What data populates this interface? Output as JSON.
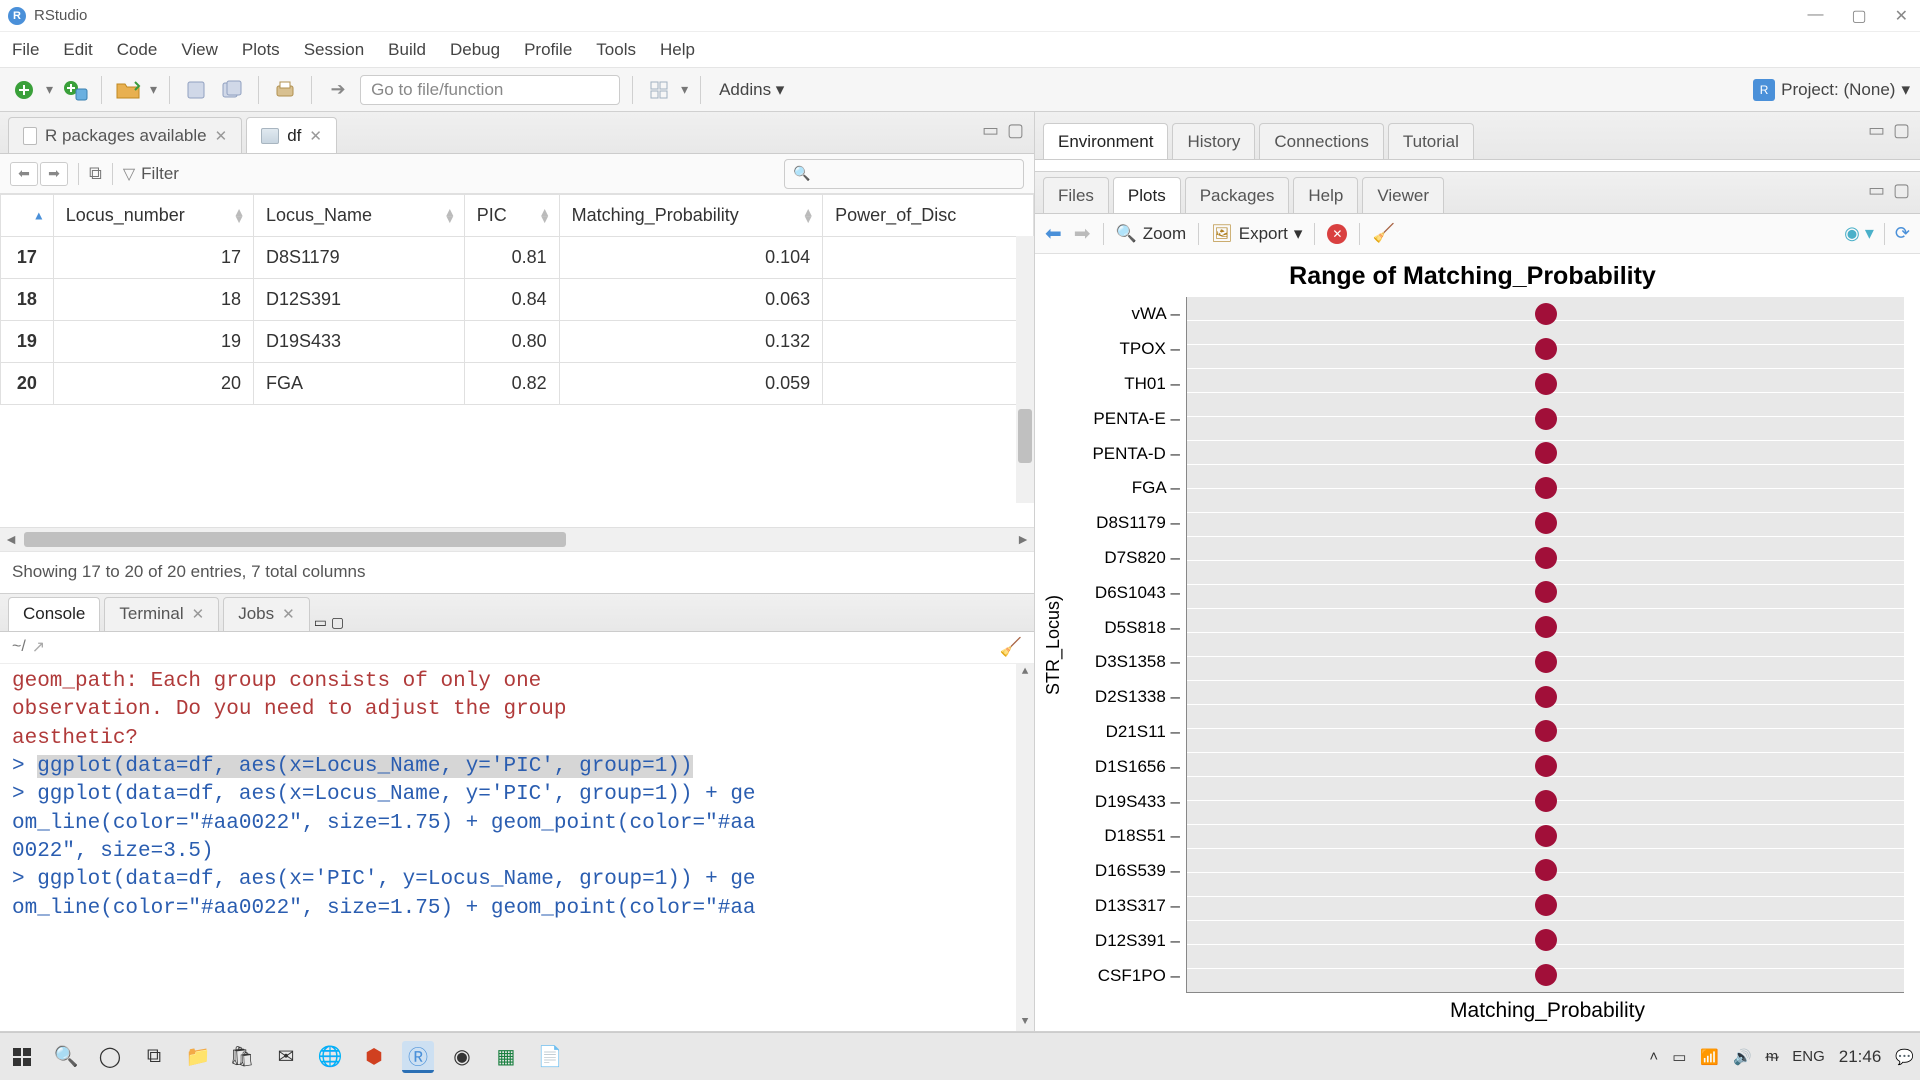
{
  "app": {
    "title": "RStudio"
  },
  "menu": [
    "File",
    "Edit",
    "Code",
    "View",
    "Plots",
    "Session",
    "Build",
    "Debug",
    "Profile",
    "Tools",
    "Help"
  ],
  "toolbar": {
    "goto_placeholder": "Go to file/function",
    "addins_label": "Addins",
    "project_label": "Project: (None)"
  },
  "source_tabs": [
    {
      "label": "R packages available",
      "active": false
    },
    {
      "label": "df",
      "active": true
    }
  ],
  "data_viewer": {
    "filter_label": "Filter",
    "columns": [
      "Locus_number",
      "Locus_Name",
      "PIC",
      "Matching_Probability",
      "Power_of_Disc"
    ],
    "rows": [
      {
        "idx": "17",
        "Locus_number": "17",
        "Locus_Name": "D8S1179",
        "PIC": "0.81",
        "Matching_Probability": "0.104"
      },
      {
        "idx": "18",
        "Locus_number": "18",
        "Locus_Name": "D12S391",
        "PIC": "0.84",
        "Matching_Probability": "0.063"
      },
      {
        "idx": "19",
        "Locus_number": "19",
        "Locus_Name": "D19S433",
        "PIC": "0.80",
        "Matching_Probability": "0.132"
      },
      {
        "idx": "20",
        "Locus_number": "20",
        "Locus_Name": "FGA",
        "PIC": "0.82",
        "Matching_Probability": "0.059"
      }
    ],
    "status": "Showing 17 to 20 of 20 entries, 7 total columns"
  },
  "console_tabs": [
    "Console",
    "Terminal",
    "Jobs"
  ],
  "console": {
    "cwd": "~/",
    "lines": [
      {
        "kind": "msg",
        "text": "geom_path: Each group consists of only one"
      },
      {
        "kind": "msg",
        "text": "observation. Do you need to adjust the group"
      },
      {
        "kind": "msg",
        "text": "aesthetic?"
      },
      {
        "kind": "inp",
        "prefix": "> ",
        "text": "ggplot(data=df, aes(x=Locus_Name, y='PIC', group=1))",
        "hl": true
      },
      {
        "kind": "inp",
        "prefix": "> ",
        "text": "ggplot(data=df, aes(x=Locus_Name, y='PIC', group=1)) + ge"
      },
      {
        "kind": "inp",
        "prefix": "",
        "text": "om_line(color=\"#aa0022\", size=1.75) + geom_point(color=\"#aa"
      },
      {
        "kind": "inp",
        "prefix": "",
        "text": "0022\", size=3.5)"
      },
      {
        "kind": "inp",
        "prefix": "> ",
        "text": "ggplot(data=df, aes(x='PIC', y=Locus_Name, group=1)) + ge"
      },
      {
        "kind": "inp",
        "prefix": "",
        "text": "om_line(color=\"#aa0022\", size=1.75) + geom_point(color=\"#aa"
      }
    ]
  },
  "env_tabs": [
    "Environment",
    "History",
    "Connections",
    "Tutorial"
  ],
  "plots_tabs": [
    "Files",
    "Plots",
    "Packages",
    "Help",
    "Viewer"
  ],
  "plots_toolbar": {
    "zoom": "Zoom",
    "export": "Export"
  },
  "chart_data": {
    "type": "scatter",
    "title": "Range of Matching_Probability",
    "ylabel": "STR_Locus)",
    "xlabel": "Matching_Probability",
    "categories": [
      "vWA",
      "TPOX",
      "TH01",
      "PENTA-E",
      "PENTA-D",
      "FGA",
      "D8S1179",
      "D7S820",
      "D6S1043",
      "D5S818",
      "D3S1358",
      "D2S1338",
      "D21S11",
      "D1S1656",
      "D19S433",
      "D18S51",
      "D16S539",
      "D13S317",
      "D12S391",
      "CSF1PO"
    ],
    "x_values": [
      0.1,
      0.1,
      0.1,
      0.1,
      0.1,
      0.1,
      0.1,
      0.1,
      0.1,
      0.1,
      0.1,
      0.1,
      0.1,
      0.1,
      0.1,
      0.1,
      0.1,
      0.1,
      0.1,
      0.1
    ],
    "x_fraction": 0.5,
    "xlim": [
      0,
      0.2
    ],
    "point_color": "#a10f39"
  },
  "taskbar": {
    "lang": "ENG",
    "clock": "21:46"
  }
}
